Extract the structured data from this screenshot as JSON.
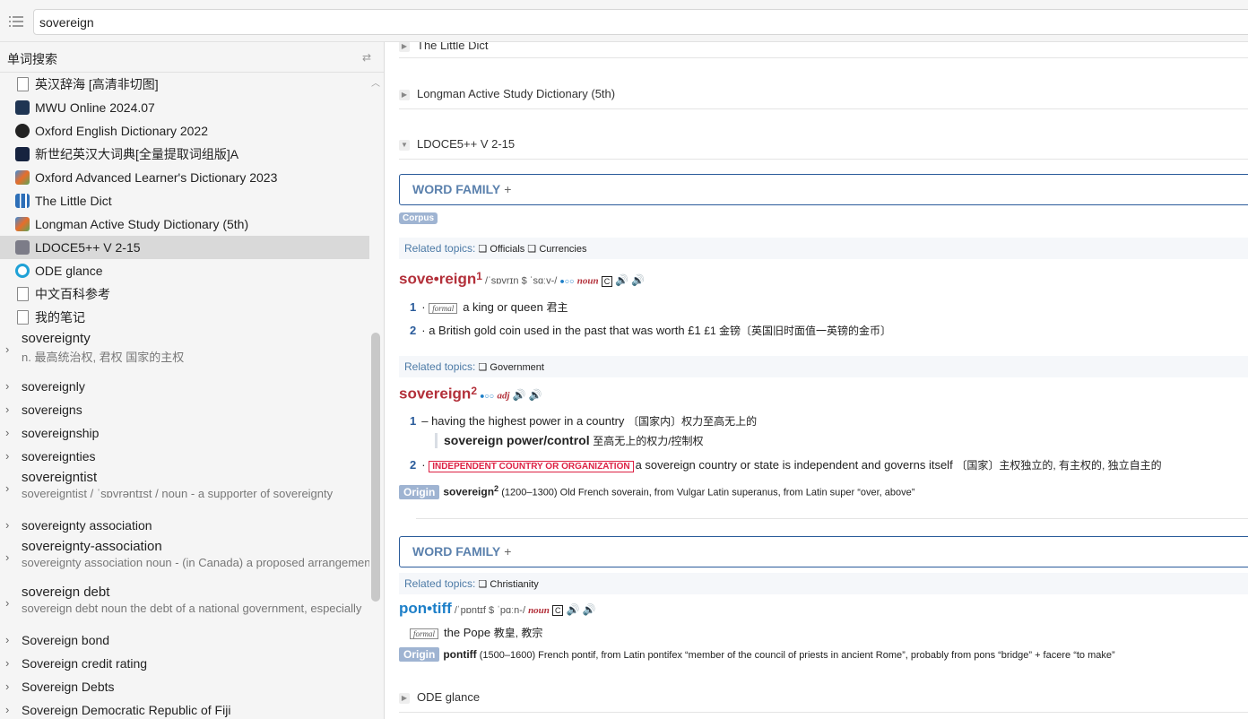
{
  "search": {
    "value": "sovereign"
  },
  "sidebar": {
    "header": "单词搜索",
    "dictionaries": [
      {
        "label": "英汉辞海 [高清非切图]",
        "icon": "document-icon"
      },
      {
        "label": "MWU Online 2024.07",
        "icon": "mwu-icon"
      },
      {
        "label": "Oxford English Dictionary 2022",
        "icon": "oed-icon"
      },
      {
        "label": "新世纪英汉大词典[全量提取词组版]A",
        "icon": "xsj-icon"
      },
      {
        "label": "Oxford Advanced Learner's Dictionary 2023",
        "icon": "oald-icon"
      },
      {
        "label": "The Little Dict",
        "icon": "little-dict-icon"
      },
      {
        "label": "Longman Active Study Dictionary (5th)",
        "icon": "longman-icon"
      },
      {
        "label": "LDOCE5++ V 2-15",
        "icon": "ldoce-icon"
      },
      {
        "label": "ODE glance",
        "icon": "ode-icon"
      },
      {
        "label": "中文百科参考",
        "icon": "document-icon"
      },
      {
        "label": "我的笔记",
        "icon": "document-icon"
      }
    ],
    "words": [
      {
        "title": "sovereignty",
        "sub": "n. 最高统治权, 君权 国家的主权"
      },
      {
        "title": "sovereignly",
        "sub": ""
      },
      {
        "title": "sovereigns",
        "sub": ""
      },
      {
        "title": "sovereignship",
        "sub": ""
      },
      {
        "title": "sovereignties",
        "sub": ""
      },
      {
        "title": "sovereigntist",
        "sub": "sovereigntist    / ˈsɒvrəntɪst /  noun -     a supporter of sovereignty"
      },
      {
        "title": "sovereignty association",
        "sub": ""
      },
      {
        "title": "sovereignty-association",
        "sub": "sovereignty association    noun -     (in Canada) a proposed arrangement"
      },
      {
        "title": "sovereign debt",
        "sub": "sovereign debt  noun    the debt of a national government, especially"
      },
      {
        "title": "Sovereign bond",
        "sub": ""
      },
      {
        "title": "Sovereign credit rating",
        "sub": ""
      },
      {
        "title": "Sovereign Debts",
        "sub": ""
      },
      {
        "title": "Sovereign Democratic Republic of Fiji",
        "sub": ""
      }
    ]
  },
  "main": {
    "sections": {
      "little_dict": "The Little Dict",
      "longman": "Longman Active Study Dictionary (5th)",
      "ldoce": "LDOCE5++ V 2-15",
      "ode": "ODE glance"
    },
    "word_family_label": "WORD FAMILY",
    "corpus_label": "Corpus",
    "related_topics_label": "Related topics:",
    "topics1": [
      "Officials",
      "Currencies"
    ],
    "entry1": {
      "headword": "sove•reign",
      "hom": "1",
      "pron": "/ˈsɒvrɪn $ ˈsɑːv-/",
      "pos": "noun",
      "gram": "C",
      "senses": [
        {
          "num": "1",
          "register": "formal",
          "def": "a king or queen",
          "zh": "君主"
        },
        {
          "num": "2",
          "register": "",
          "def": "a British gold coin used in the past that was worth £1",
          "zh": "£1 金镑〔英国旧时面值一英镑的金币〕"
        }
      ]
    },
    "topics2": [
      "Government"
    ],
    "entry2": {
      "headword": "sovereign",
      "hom": "2",
      "pos": "adj",
      "sense1": {
        "num": "1",
        "def": "having the highest power in a country",
        "zh": "〔国家内〕权力至高无上的"
      },
      "colloc": {
        "phrase": "sovereign power/control",
        "zh": "至高无上的权力/控制权"
      },
      "sense2": {
        "num": "2",
        "signpost": "INDEPENDENT COUNTRY OR ORGANIZATION",
        "def": "a sovereign country or state is independent and governs itself",
        "zh": "〔国家〕主权独立的, 有主权的, 独立自主的"
      },
      "origin": {
        "label": "Origin",
        "word": "sovereign",
        "hom": "2",
        "text": "(1200–1300) Old French soverain, from Vulgar Latin superanus, from Latin super “over, above”"
      }
    },
    "topics3": [
      "Christianity"
    ],
    "entry3": {
      "headword": "pon•tiff",
      "pron": "/ˈpɒntɪf $ ˈpɑːn-/",
      "pos": "noun",
      "gram": "C",
      "sense": {
        "register": "formal",
        "def": "the Pope",
        "zh": "教皇, 教宗"
      },
      "origin": {
        "label": "Origin",
        "word": "pontiff",
        "text": "(1500–1600) French pontif, from Latin pontifex “member of the council of priests in ancient Rome”, probably from pons “bridge” + facere “to make”"
      }
    }
  }
}
